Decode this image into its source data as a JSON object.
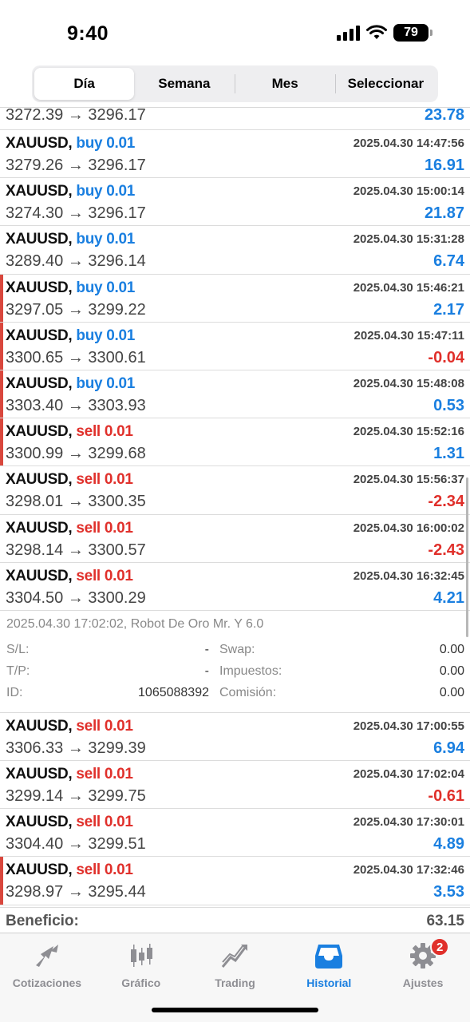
{
  "status": {
    "time": "9:40",
    "battery": "79"
  },
  "segments": [
    {
      "label": "Día",
      "active": true
    },
    {
      "label": "Semana",
      "active": false
    },
    {
      "label": "Mes",
      "active": false
    },
    {
      "label": "Seleccionar",
      "active": false
    }
  ],
  "partial_row": {
    "prices": "3272.39 → 3296.17",
    "profit": "23.78"
  },
  "trades_a": [
    {
      "symbol": "XAUUSD,",
      "side": "buy 0.01",
      "time": "2025.04.30 14:47:56",
      "prices": "3279.26 → 3296.17",
      "profit": "16.91"
    },
    {
      "symbol": "XAUUSD,",
      "side": "buy 0.01",
      "time": "2025.04.30 15:00:14",
      "prices": "3274.30 → 3296.17",
      "profit": "21.87"
    },
    {
      "symbol": "XAUUSD,",
      "side": "buy 0.01",
      "time": "2025.04.30 15:31:28",
      "prices": "3289.40 → 3296.14",
      "profit": "6.74"
    },
    {
      "symbol": "XAUUSD,",
      "side": "buy 0.01",
      "time": "2025.04.30 15:46:21",
      "prices": "3297.05 → 3299.22",
      "profit": "2.17"
    },
    {
      "symbol": "XAUUSD,",
      "side": "buy 0.01",
      "time": "2025.04.30 15:47:11",
      "prices": "3300.65 → 3300.61",
      "profit": "-0.04"
    },
    {
      "symbol": "XAUUSD,",
      "side": "buy 0.01",
      "time": "2025.04.30 15:48:08",
      "prices": "3303.40 → 3303.93",
      "profit": "0.53"
    },
    {
      "symbol": "XAUUSD,",
      "side": "sell 0.01",
      "time": "2025.04.30 15:52:16",
      "prices": "3300.99 → 3299.68",
      "profit": "1.31"
    },
    {
      "symbol": "XAUUSD,",
      "side": "sell 0.01",
      "time": "2025.04.30 15:56:37",
      "prices": "3298.01 → 3300.35",
      "profit": "-2.34"
    },
    {
      "symbol": "XAUUSD,",
      "side": "sell 0.01",
      "time": "2025.04.30 16:00:02",
      "prices": "3298.14 → 3300.57",
      "profit": "-2.43"
    },
    {
      "symbol": "XAUUSD,",
      "side": "sell 0.01",
      "time": "2025.04.30 16:32:45",
      "prices": "3304.50 → 3300.29",
      "profit": "4.21"
    }
  ],
  "details": {
    "comment": "2025.04.30 17:02:02, Robot De Oro Mr. Y 6.0",
    "sl_label": "S/L:",
    "sl_value": "-",
    "tp_label": "T/P:",
    "tp_value": "-",
    "id_label": "ID:",
    "id_value": "1065088392",
    "swap_label": "Swap:",
    "swap_value": "0.00",
    "tax_label": "Impuestos:",
    "tax_value": "0.00",
    "commission_label": "Comisión:",
    "commission_value": "0.00"
  },
  "trades_b": [
    {
      "symbol": "XAUUSD,",
      "side": "sell 0.01",
      "time": "2025.04.30 17:00:55",
      "prices": "3306.33 → 3299.39",
      "profit": "6.94"
    },
    {
      "symbol": "XAUUSD,",
      "side": "sell 0.01",
      "time": "2025.04.30 17:02:04",
      "prices": "3299.14 → 3299.75",
      "profit": "-0.61"
    },
    {
      "symbol": "XAUUSD,",
      "side": "sell 0.01",
      "time": "2025.04.30 17:30:01",
      "prices": "3304.40 → 3299.51",
      "profit": "4.89"
    },
    {
      "symbol": "XAUUSD,",
      "side": "sell 0.01",
      "time": "2025.04.30 17:32:46",
      "prices": "3298.97 → 3295.44",
      "profit": "3.53"
    }
  ],
  "total": {
    "label": "Beneficio:",
    "value": "63.15"
  },
  "tabs": [
    {
      "label": "Cotizaciones",
      "icon": "quotes-icon"
    },
    {
      "label": "Gráfico",
      "icon": "candlestick-chart-icon"
    },
    {
      "label": "Trading",
      "icon": "trading-icon"
    },
    {
      "label": "Historial",
      "icon": "history-inbox-icon",
      "active": true
    },
    {
      "label": "Ajustes",
      "icon": "settings-gear-icon",
      "badge": "2"
    }
  ],
  "colors": {
    "buy": "#1a7fe0",
    "sell": "#e0302b",
    "accent": "#1a7fe0"
  }
}
